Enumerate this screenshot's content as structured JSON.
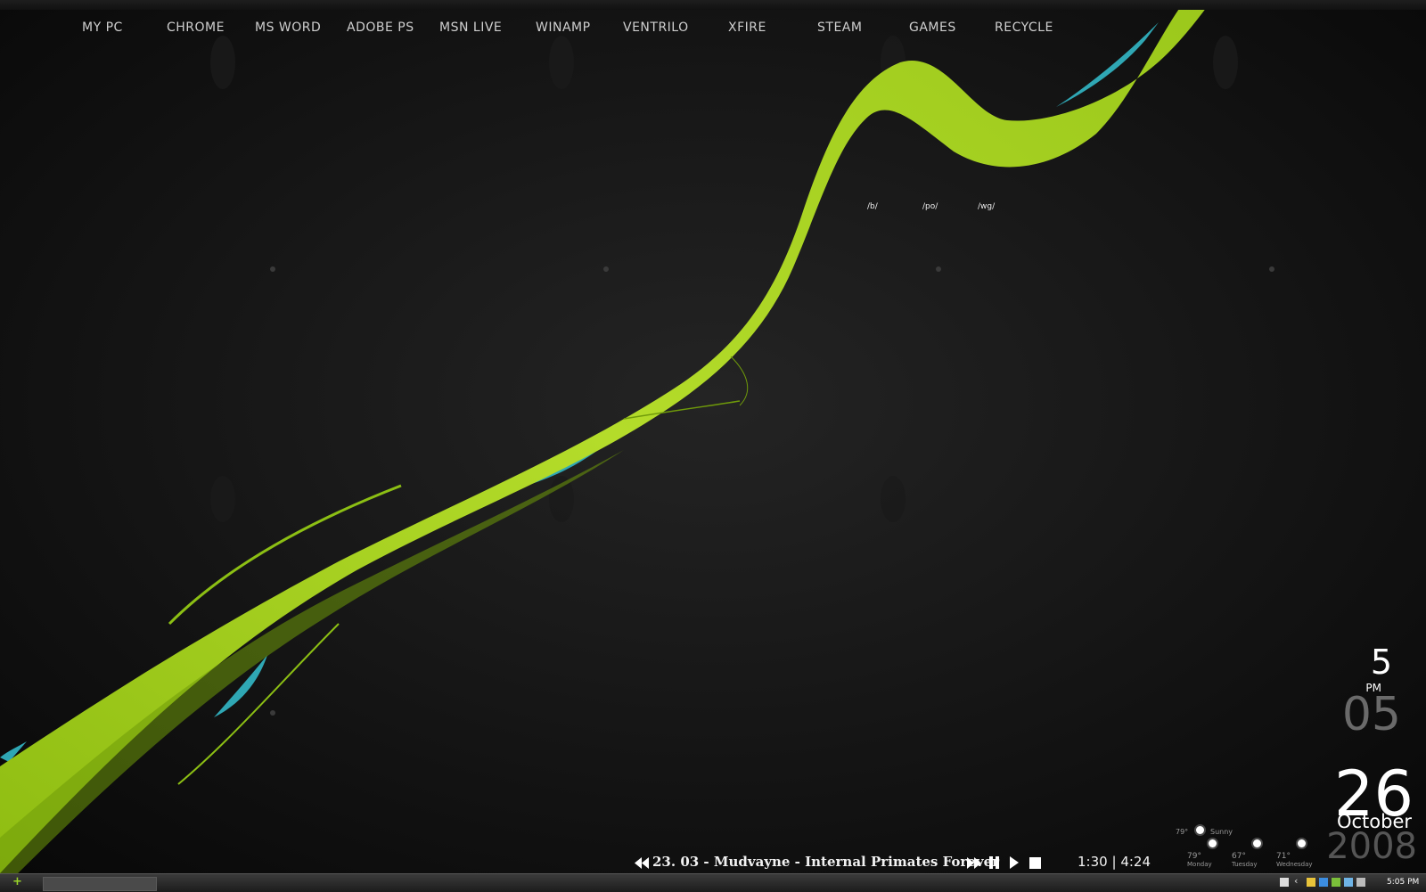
{
  "launcher": {
    "items": [
      "MY PC",
      "CHROME",
      "MS WORD",
      "ADOBE PS",
      "MSN LIVE",
      "WINAMP",
      "VENTRILO",
      "XFIRE",
      "STEAM",
      "GAMES",
      "RECYCLE"
    ]
  },
  "board_tags": [
    "/b/",
    "/po/",
    "/wg/"
  ],
  "clock": {
    "hour": "5",
    "ampm": "PM",
    "minute": "05",
    "day": "26",
    "month": "October",
    "year": "2008"
  },
  "weather": {
    "current": {
      "temp": "79°",
      "condition": "Sunny",
      "icon": "sun-icon"
    },
    "forecast": [
      {
        "temp": "79°",
        "day": "Monday",
        "icon": "sun-icon"
      },
      {
        "temp": "67°",
        "day": "Tuesday",
        "icon": "sun-icon"
      },
      {
        "temp": "71°",
        "day": "Wednesday",
        "icon": "sun-icon"
      }
    ]
  },
  "player": {
    "track": "23. 03 - Mudvayne - Internal Primates Forever",
    "elapsed": "1:30",
    "separator": "|",
    "total": "4:24",
    "controls": [
      "previous-icon",
      "next-icon",
      "pause-icon",
      "play-icon",
      "stop-icon"
    ]
  },
  "taskbar": {
    "start_icon": "start-orb-icon",
    "tray_time": "5:05 PM",
    "tray_icons": [
      "help-icon",
      "arrow-icon",
      "network-icon",
      "volume-icon",
      "messenger-icon",
      "update-icon"
    ]
  },
  "colors": {
    "ribbon_green": "#a6d11e",
    "ribbon_teal": "#2fa7b4",
    "background": "#0d0d0d"
  }
}
